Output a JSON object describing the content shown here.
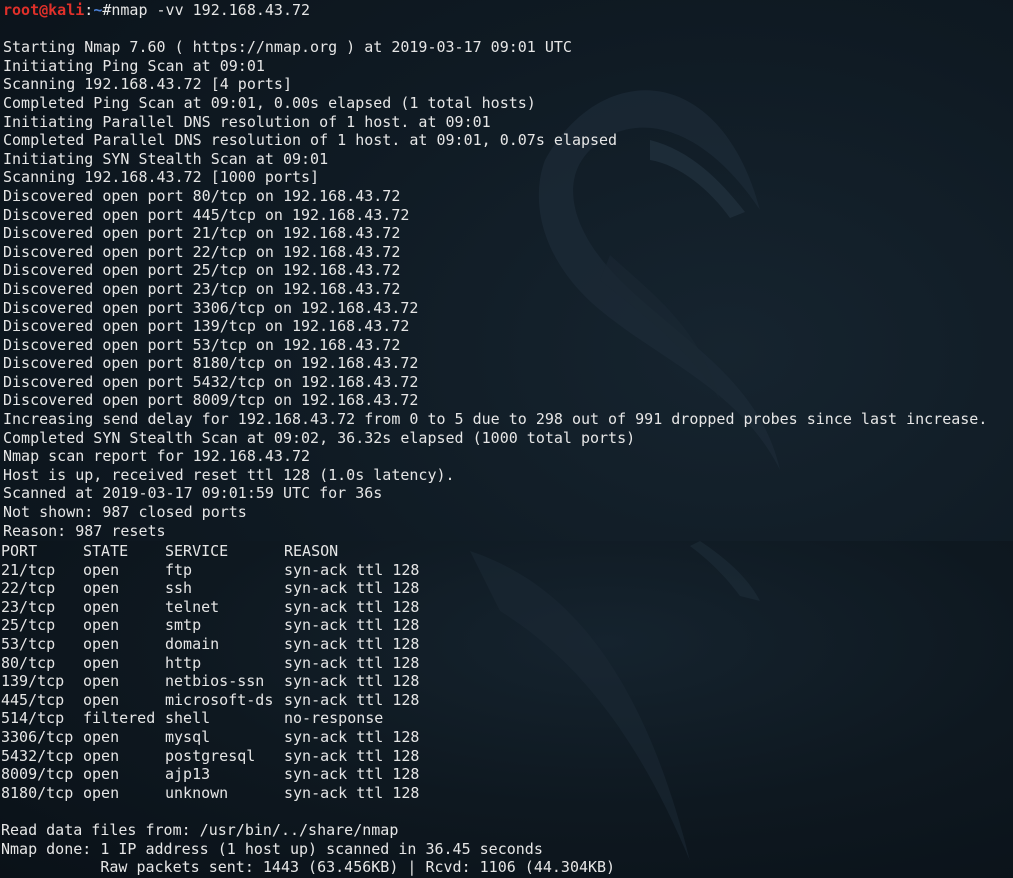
{
  "prompt": {
    "user_host": "root@kali",
    "sep": ":",
    "path": "~",
    "symbol": "#",
    "command": "nmap -vv 192.168.43.72"
  },
  "top_output": [
    "",
    "Starting Nmap 7.60 ( https://nmap.org ) at 2019-03-17 09:01 UTC",
    "Initiating Ping Scan at 09:01",
    "Scanning 192.168.43.72 [4 ports]",
    "Completed Ping Scan at 09:01, 0.00s elapsed (1 total hosts)",
    "Initiating Parallel DNS resolution of 1 host. at 09:01",
    "Completed Parallel DNS resolution of 1 host. at 09:01, 0.07s elapsed",
    "Initiating SYN Stealth Scan at 09:01",
    "Scanning 192.168.43.72 [1000 ports]",
    "Discovered open port 80/tcp on 192.168.43.72",
    "Discovered open port 445/tcp on 192.168.43.72",
    "Discovered open port 21/tcp on 192.168.43.72",
    "Discovered open port 22/tcp on 192.168.43.72",
    "Discovered open port 25/tcp on 192.168.43.72",
    "Discovered open port 23/tcp on 192.168.43.72",
    "Discovered open port 3306/tcp on 192.168.43.72",
    "Discovered open port 139/tcp on 192.168.43.72",
    "Discovered open port 53/tcp on 192.168.43.72",
    "Discovered open port 8180/tcp on 192.168.43.72",
    "Discovered open port 5432/tcp on 192.168.43.72",
    "Discovered open port 8009/tcp on 192.168.43.72",
    "Increasing send delay for 192.168.43.72 from 0 to 5 due to 298 out of 991 dropped probes since last increase.",
    "Completed SYN Stealth Scan at 09:02, 36.32s elapsed (1000 total ports)",
    "Nmap scan report for 192.168.43.72",
    "Host is up, received reset ttl 128 (1.0s latency).",
    "Scanned at 2019-03-17 09:01:59 UTC for 36s",
    "Not shown: 987 closed ports",
    "Reason: 987 resets"
  ],
  "port_table": {
    "headers": [
      "PORT",
      "STATE",
      "SERVICE",
      "REASON"
    ],
    "rows": [
      [
        "21/tcp",
        "open",
        "ftp",
        "syn-ack ttl 128"
      ],
      [
        "22/tcp",
        "open",
        "ssh",
        "syn-ack ttl 128"
      ],
      [
        "23/tcp",
        "open",
        "telnet",
        "syn-ack ttl 128"
      ],
      [
        "25/tcp",
        "open",
        "smtp",
        "syn-ack ttl 128"
      ],
      [
        "53/tcp",
        "open",
        "domain",
        "syn-ack ttl 128"
      ],
      [
        "80/tcp",
        "open",
        "http",
        "syn-ack ttl 128"
      ],
      [
        "139/tcp",
        "open",
        "netbios-ssn",
        "syn-ack ttl 128"
      ],
      [
        "445/tcp",
        "open",
        "microsoft-ds",
        "syn-ack ttl 128"
      ],
      [
        "514/tcp",
        "filtered",
        "shell",
        "no-response"
      ],
      [
        "3306/tcp",
        "open",
        "mysql",
        "syn-ack ttl 128"
      ],
      [
        "5432/tcp",
        "open",
        "postgresql",
        "syn-ack ttl 128"
      ],
      [
        "8009/tcp",
        "open",
        "ajp13",
        "syn-ack ttl 128"
      ],
      [
        "8180/tcp",
        "open",
        "unknown",
        "syn-ack ttl 128"
      ]
    ]
  },
  "bottom_output": [
    "",
    "Read data files from: /usr/bin/../share/nmap",
    "Nmap done: 1 IP address (1 host up) scanned in 36.45 seconds",
    "           Raw packets sent: 1443 (63.456KB) | Rcvd: 1106 (44.304KB)"
  ],
  "colors": {
    "background": "#0f1a23",
    "text": "#e6e6e6",
    "prompt_user": "#e0302a",
    "prompt_path": "#4a7fd4"
  }
}
